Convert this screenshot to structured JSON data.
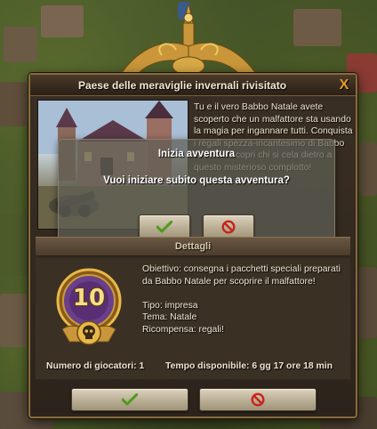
{
  "window": {
    "title": "Paese delle meraviglie invernali rivisitato",
    "close_label": "X"
  },
  "story": {
    "text": "Tu e il vero Babbo Natale avete scoperto che un malfattore sta usando la magia per ingannare tutti. Conquista i regali spezza-incantesimo di Babbo Natale e scopri chi si cela dietro a questo misterioso complotto!"
  },
  "popup": {
    "title": "Inizia avventura",
    "question": "Vuoi iniziare subito questa avventura?"
  },
  "details": {
    "section_title": "Dettagli",
    "level": "10",
    "objective": "Obiettivo: consegna i pacchetti speciali preparati da Babbo Natale per scoprire il malfattore!",
    "type": "Tipo: impresa",
    "theme": "Tema: Natale",
    "reward": "Ricompensa: regali!",
    "players": "Numero di giocatori: 1",
    "time": "Tempo disponibile: 6 gg 17 ore 18 min"
  },
  "icons": {
    "accept": "checkmark-icon",
    "decline": "forbidden-icon",
    "badge": "skull-icon"
  },
  "colors": {
    "accept_green": "#4f9a1c",
    "decline_red": "#c8241a",
    "badge_gold": "#e8b84a",
    "badge_purple": "#6a3f8a"
  }
}
